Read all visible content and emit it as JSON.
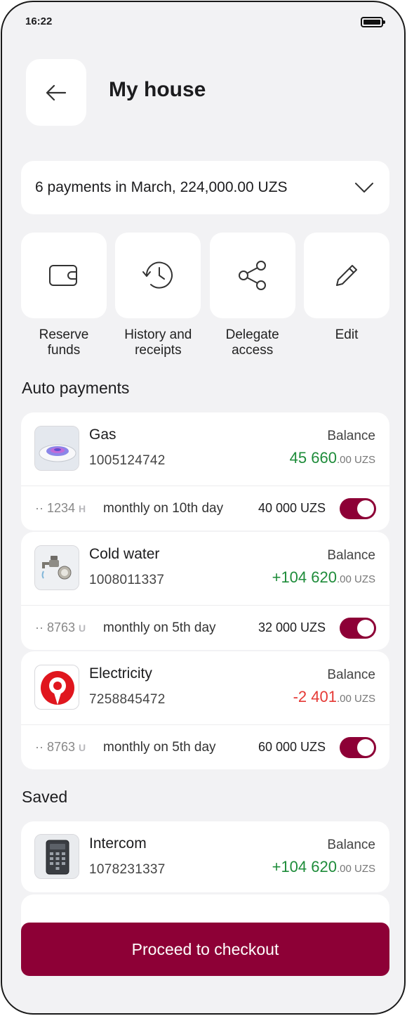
{
  "status": {
    "time": "16:22"
  },
  "header": {
    "title": "My house"
  },
  "summary": {
    "text": "6 payments in March, 224,000.00 UZS"
  },
  "actions": [
    {
      "label": "Reserve funds",
      "icon": "wallet-icon"
    },
    {
      "label": "History and receipts",
      "icon": "history-icon"
    },
    {
      "label": "Delegate access",
      "icon": "share-icon"
    },
    {
      "label": "Edit",
      "icon": "pencil-icon"
    }
  ],
  "auto_payments": {
    "title": "Auto payments",
    "items": [
      {
        "name": "Gas",
        "account": "1005124742",
        "balance_label": "Balance",
        "balance_main": "45 660",
        "balance_dec": ".00 UZS",
        "balance_sign": "positive",
        "card_mask": "·· 1234",
        "card_logo": "H",
        "schedule": "monthly on 10th day",
        "amount": "40 000 UZS",
        "enabled": true
      },
      {
        "name": "Cold water",
        "account": "1008011337",
        "balance_label": "Balance",
        "balance_main": "+104 620",
        "balance_dec": ".00 UZS",
        "balance_sign": "positive",
        "card_mask": "·· 8763",
        "card_logo": "U",
        "schedule": "monthly on 5th day",
        "amount": "32 000 UZS",
        "enabled": true
      },
      {
        "name": "Electricity",
        "account": "7258845472",
        "balance_label": "Balance",
        "balance_main": "-2 401",
        "balance_dec": ".00 UZS",
        "balance_sign": "negative",
        "card_mask": "·· 8763",
        "card_logo": "U",
        "schedule": "monthly on 5th day",
        "amount": "60 000 UZS",
        "enabled": true
      }
    ]
  },
  "saved": {
    "title": "Saved",
    "items": [
      {
        "name": "Intercom",
        "account": "1078231337",
        "balance_label": "Balance",
        "balance_main": "+104 620",
        "balance_dec": ".00 UZS",
        "balance_sign": "positive"
      }
    ]
  },
  "footer": {
    "checkout_label": "Proceed to checkout"
  },
  "colors": {
    "brand": "#8d0036",
    "positive": "#1e8c3a",
    "negative": "#e53935",
    "background": "#f2f2f4"
  }
}
